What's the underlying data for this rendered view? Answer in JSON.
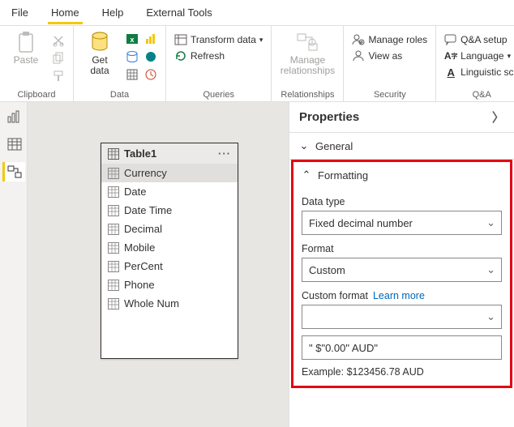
{
  "tabs": {
    "file": "File",
    "home": "Home",
    "help": "Help",
    "ext": "External Tools"
  },
  "ribbon": {
    "clipboard": {
      "paste": "Paste",
      "group": "Clipboard"
    },
    "data": {
      "getdata": "Get\ndata",
      "group": "Data"
    },
    "queries": {
      "transform": "Transform data",
      "refresh": "Refresh",
      "group": "Queries"
    },
    "relationships": {
      "manage": "Manage\nrelationships",
      "group": "Relationships"
    },
    "security": {
      "roles": "Manage roles",
      "viewas": "View as",
      "group": "Security"
    },
    "qa": {
      "setup": "Q&A setup",
      "language": "Language",
      "schema": "Linguistic sch",
      "group": "Q&A"
    }
  },
  "table": {
    "title": "Table1",
    "columns": [
      "Currency",
      "Date",
      "Date Time",
      "Decimal",
      "Mobile",
      "PerCent",
      "Phone",
      "Whole Num"
    ]
  },
  "properties": {
    "title": "Properties",
    "general": "General",
    "formatting": "Formatting",
    "datatype_label": "Data type",
    "datatype_value": "Fixed decimal number",
    "format_label": "Format",
    "format_value": "Custom",
    "customformat_label": "Custom format",
    "learnmore": "Learn more",
    "customformat_select": "",
    "customformat_text": "\" $\"0.00\" AUD\"",
    "example": "Example: $123456.78 AUD"
  }
}
